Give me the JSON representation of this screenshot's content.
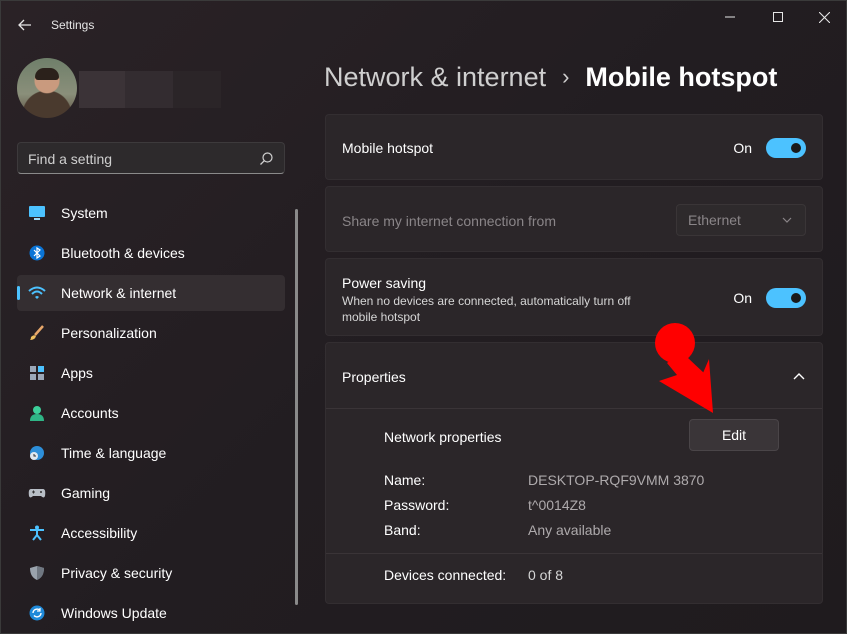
{
  "window": {
    "title": "Settings"
  },
  "search": {
    "placeholder": "Find a setting"
  },
  "sidebar": {
    "items": [
      {
        "label": "System",
        "icon": "monitor-icon"
      },
      {
        "label": "Bluetooth & devices",
        "icon": "bluetooth-icon"
      },
      {
        "label": "Network & internet",
        "icon": "wifi-icon",
        "active": true
      },
      {
        "label": "Personalization",
        "icon": "brush-icon"
      },
      {
        "label": "Apps",
        "icon": "apps-icon"
      },
      {
        "label": "Accounts",
        "icon": "person-icon"
      },
      {
        "label": "Time & language",
        "icon": "globe-clock-icon"
      },
      {
        "label": "Gaming",
        "icon": "gamepad-icon"
      },
      {
        "label": "Accessibility",
        "icon": "accessibility-icon"
      },
      {
        "label": "Privacy & security",
        "icon": "shield-icon"
      },
      {
        "label": "Windows Update",
        "icon": "update-icon"
      }
    ]
  },
  "breadcrumb": {
    "parent": "Network & internet",
    "separator": "›",
    "current": "Mobile hotspot"
  },
  "hotspot": {
    "title": "Mobile hotspot",
    "state": "On"
  },
  "share": {
    "title": "Share my internet connection from",
    "value": "Ethernet"
  },
  "power_saving": {
    "title": "Power saving",
    "description": "When no devices are connected, automatically turn off mobile hotspot",
    "state": "On"
  },
  "properties": {
    "title": "Properties",
    "network_properties_label": "Network properties",
    "edit_label": "Edit",
    "name_label": "Name:",
    "name_value": "DESKTOP-RQF9VMM 3870",
    "password_label": "Password:",
    "password_value": "t^0014Z8",
    "band_label": "Band:",
    "band_value": "Any available",
    "devices_label": "Devices connected:",
    "devices_value": "0 of 8"
  },
  "colors": {
    "accent": "#4cc2ff",
    "marker": "#ff0000"
  }
}
